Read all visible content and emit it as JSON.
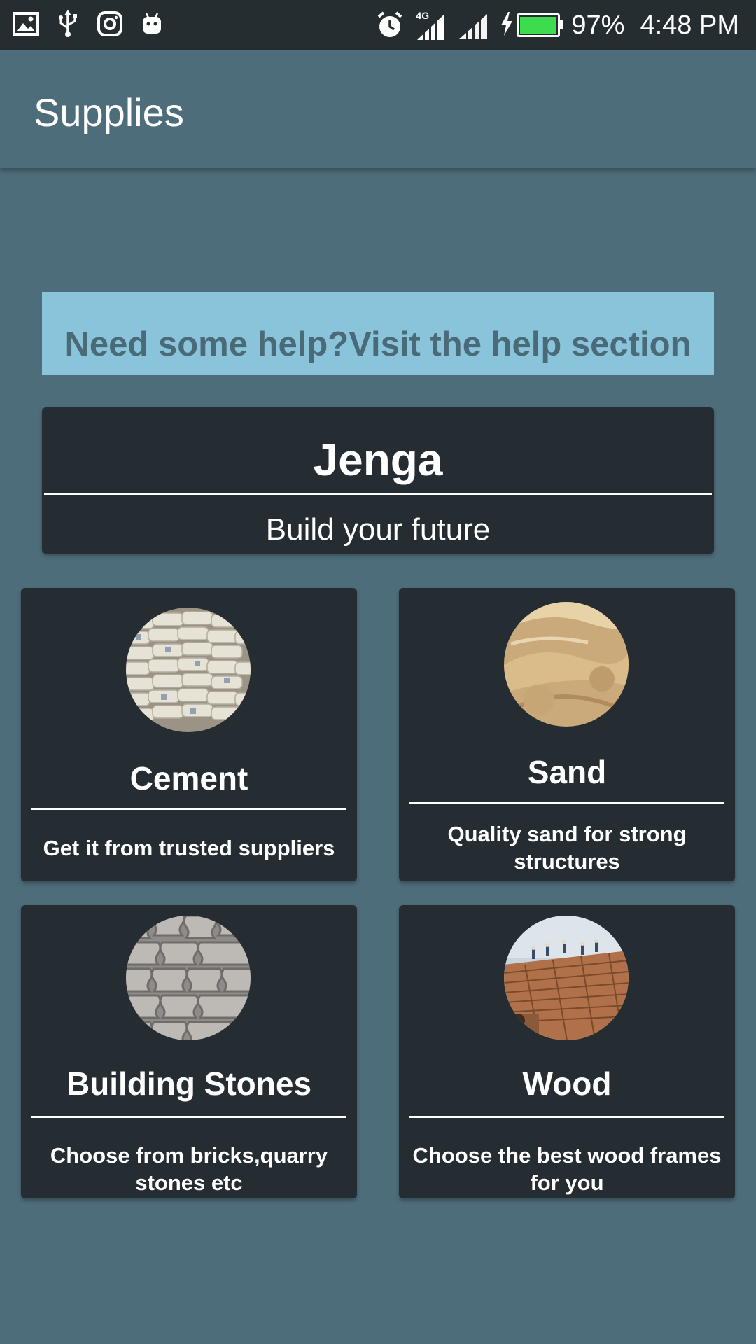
{
  "status_bar": {
    "battery_percent": "97%",
    "battery_level": 0.97,
    "time": "4:48 PM",
    "network_type": "4G",
    "icons_left": [
      "image-icon",
      "usb-icon",
      "instagram-icon",
      "android-icon"
    ],
    "icons_right": [
      "alarm-icon",
      "signal-4g-icon",
      "signal-icon",
      "charging-icon",
      "battery-icon"
    ],
    "battery_color": "#3ddc4e"
  },
  "app_bar": {
    "title": "Supplies",
    "background": "#4e6d7a"
  },
  "help_banner": {
    "text": "Need some help?Visit the help section",
    "background": "#8ac4db"
  },
  "brand_card": {
    "title": "Jenga",
    "subtitle": "Build your future"
  },
  "cards": [
    {
      "title": "Cement",
      "description": "Get it from trusted suppliers",
      "image": "cement-bags-image"
    },
    {
      "title": "Sand",
      "description": "Quality sand for strong structures",
      "image": "sand-pile-image"
    },
    {
      "title": "Building Stones",
      "description": "Choose from bricks,quarry stones etc",
      "image": "paving-stones-image"
    },
    {
      "title": "Wood",
      "description": "Choose the best wood frames for you",
      "image": "wood-roof-image"
    }
  ]
}
